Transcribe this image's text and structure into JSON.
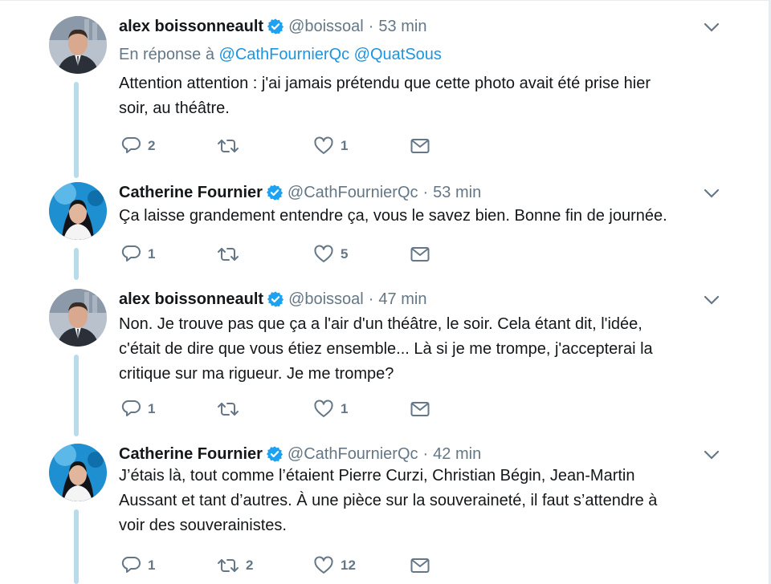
{
  "tweets": [
    {
      "name": "alex boissonneault",
      "handle": "@boissoal",
      "time": "53 min",
      "reply_prefix": "En réponse à",
      "reply_handles": "@CathFournierQc @QuatSous",
      "text": "Attention attention : j'ai jamais prétendu que cette photo avait été prise hier\nsoir, au théâtre.",
      "replies": "2",
      "retweets": "",
      "likes": "1",
      "avatar": "man-in-suit"
    },
    {
      "name": "Catherine Fournier",
      "handle": "@CathFournierQc",
      "time": "53 min",
      "text": "Ça laisse grandement entendre ça, vous le savez bien. Bonne fin de journée.",
      "replies": "1",
      "retweets": "",
      "likes": "5",
      "avatar": "woman-dark-hair"
    },
    {
      "name": "alex boissonneault",
      "handle": "@boissoal",
      "time": "47 min",
      "text": "Non. Je trouve pas que ça a l'air d'un théâtre, le soir. Cela étant dit, l'idée,\nc'était de dire que vous étiez ensemble... Là si je me trompe, j'accepterai la\ncritique sur ma rigueur. Je me trompe?",
      "replies": "1",
      "retweets": "",
      "likes": "1",
      "avatar": "man-in-suit"
    },
    {
      "name": "Catherine Fournier",
      "handle": "@CathFournierQc",
      "time": "42 min",
      "text": "J’étais là, tout comme l’étaient Pierre Curzi, Christian Bégin, Jean-Martin\nAussant et tant d’autres. À une pièce sur la souveraineté, il faut s’attendre à\nvoir des souverainistes.",
      "replies": "1",
      "retweets": "2",
      "likes": "12",
      "avatar": "woman-dark-hair"
    }
  ],
  "colors": {
    "verified": "#1da1f2",
    "link": "#1b95e0",
    "muted": "#657786",
    "thread_line": "#b8dcec"
  },
  "icons": [
    "verified-badge-icon",
    "chevron-down-icon",
    "reply-icon",
    "retweet-icon",
    "like-icon",
    "direct-message-icon"
  ]
}
